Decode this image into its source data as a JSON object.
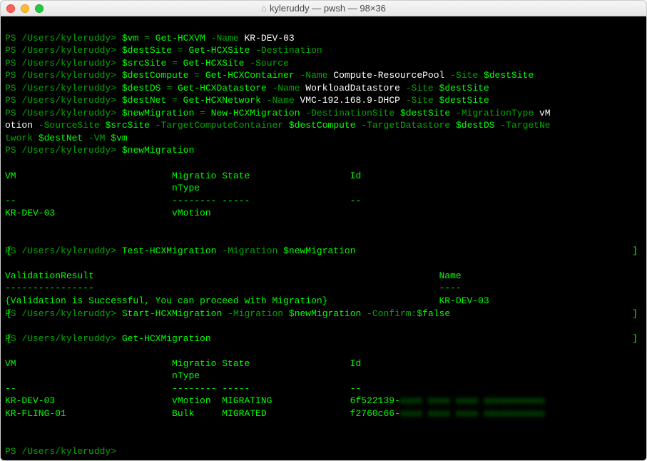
{
  "window": {
    "title": "kyleruddy — pwsh — 98×36"
  },
  "prompt": "PS /Users/kyleruddy>",
  "lines": {
    "l1_var": "$vm",
    "l1_eq": " = ",
    "l1_cmd": "Get-HCXVM",
    "l1_flag": " -Name ",
    "l1_val": "KR-DEV-03",
    "l2_var": "$destSite",
    "l2_eq": " = ",
    "l2_cmd": "Get-HCXSite",
    "l2_flag": " -Destination",
    "l3_var": "$srcSite",
    "l3_eq": " = ",
    "l3_cmd": "Get-HCXSite",
    "l3_flag": " -Source",
    "l4_var": "$destCompute",
    "l4_eq": " = ",
    "l4_cmd": "Get-HCXContainer",
    "l4_flag1": " -Name ",
    "l4_val1": "Compute-ResourcePool",
    "l4_flag2": " -Site ",
    "l4_var2": "$destSite",
    "l5_var": "$destDS",
    "l5_eq": " = ",
    "l5_cmd": "Get-HCXDatastore",
    "l5_flag1": " -Name ",
    "l5_val1": "WorkloadDatastore",
    "l5_flag2": " -Site ",
    "l5_var2": "$destSite",
    "l6_var": "$destNet",
    "l6_eq": " = ",
    "l6_cmd": "Get-HCXNetwork",
    "l6_flag1": " -Name ",
    "l6_val1": "VMC-192.168.9-DHCP",
    "l6_flag2": " -Site ",
    "l6_var2": "$destSite",
    "l7_var": "$newMigration",
    "l7_eq": " = ",
    "l7_cmd": "New-HCXMigration",
    "l7_flag1": " -DestinationSite ",
    "l7_v1": "$destSite",
    "l7_flag2": " -MigrationType ",
    "l7_v2": "vM",
    "l7b_v2": "otion",
    "l7b_flag3": " -SourceSite ",
    "l7b_v3": "$srcSite",
    "l7b_flag4": " -TargetComputeContainer ",
    "l7b_v4": "$destCompute",
    "l7b_flag5": " -TargetDatastore ",
    "l7b_v5": "$destDS",
    "l7b_flag6": " -TargetNe",
    "l7c_flag6": "twork ",
    "l7c_v6": "$destNet",
    "l7c_flag7": " -VM ",
    "l7c_v7": "$vm",
    "l8_var": "$newMigration",
    "hdr1": "VM                            Migratio State                  Id",
    "hdr1b": "                              nType",
    "hdr1c": "--                            -------- -----                  --",
    "row1": "KR-DEV-03                     vMotion",
    "l9_cmd": "Test-HCXMigration",
    "l9_flag": " -Migration ",
    "l9_var": "$newMigration",
    "vr_hdr": "ValidationResult                                                              Name",
    "vr_sep": "----------------                                                              ----",
    "vr_row": "{Validation is Successful, You can proceed with Migration}                    KR-DEV-03",
    "l10_cmd": "Start-HCXMigration",
    "l10_flag1": " -Migration ",
    "l10_var1": "$newMigration",
    "l10_flag2": " -Confirm:",
    "l10_var2": "$false",
    "l11_cmd": "Get-HCXMigration",
    "hdr2": "VM                            Migratio State                  Id",
    "hdr2b": "                              nType",
    "hdr2c": "--                            -------- -----                  --",
    "row2a": "KR-DEV-03                     vMotion  MIGRATING              6f522139-",
    "row2a_blur": "xxxx xxxx xxxx xxxxxxxxxxx",
    "row2b": "KR-FLING-01                   Bulk     MIGRATED               f2760c66-",
    "row2b_blur": "xxxx xxxx xxxx xxxxxxxxxxx"
  }
}
